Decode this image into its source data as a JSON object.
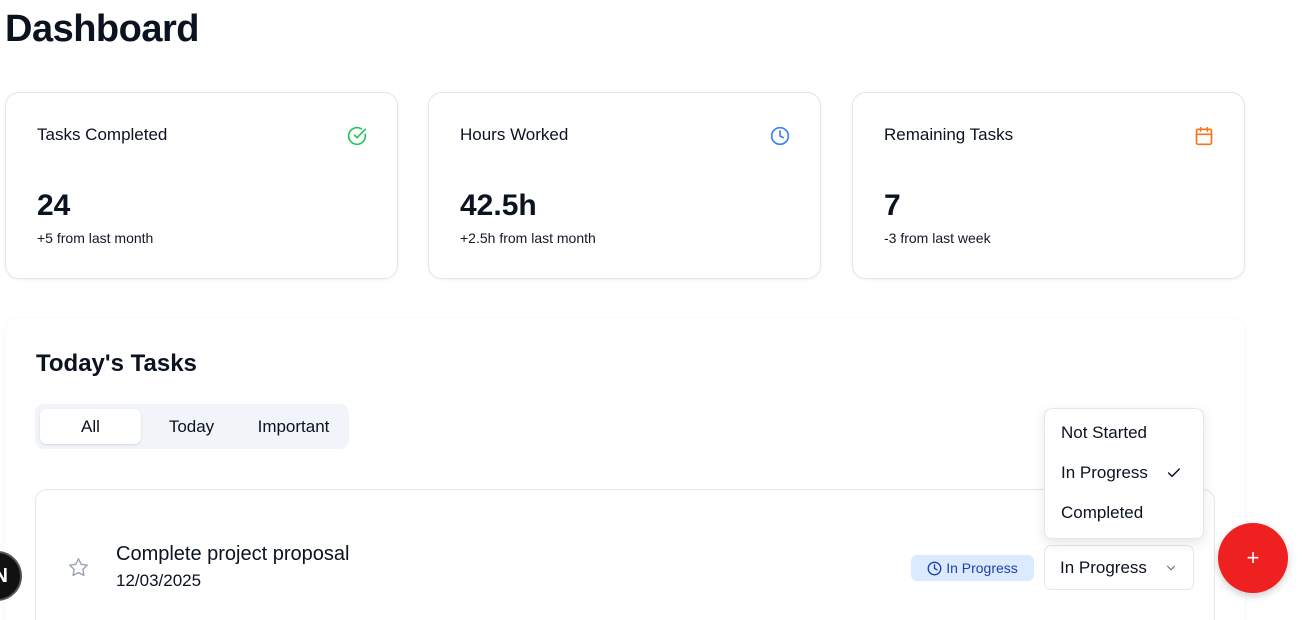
{
  "page": {
    "title": "Dashboard"
  },
  "stats": [
    {
      "label": "Tasks Completed",
      "value": "24",
      "sub": "+5 from last month",
      "icon": "check-circle-icon",
      "color": "#22c55e"
    },
    {
      "label": "Hours Worked",
      "value": "42.5h",
      "sub": "+2.5h from last month",
      "icon": "clock-icon",
      "color": "#3b82f6"
    },
    {
      "label": "Remaining Tasks",
      "value": "7",
      "sub": "-3 from last week",
      "icon": "calendar-icon",
      "color": "#f97316"
    }
  ],
  "tasks": {
    "title": "Today's Tasks",
    "tabs": [
      {
        "label": "All",
        "active": true
      },
      {
        "label": "Today",
        "active": false
      },
      {
        "label": "Important",
        "active": false
      }
    ],
    "items": [
      {
        "title": "Complete project proposal",
        "date": "12/03/2025",
        "badge": "In Progress",
        "status": "In Progress"
      }
    ]
  },
  "status_menu": {
    "options": [
      "Not Started",
      "In Progress",
      "Completed"
    ],
    "selected": "In Progress"
  },
  "fab": {
    "label": "+"
  },
  "corner_badge": {
    "label": "N"
  },
  "colors": {
    "accent_red": "#ef2020",
    "badge_bg": "#dbeafe",
    "badge_text": "#1e40af"
  }
}
